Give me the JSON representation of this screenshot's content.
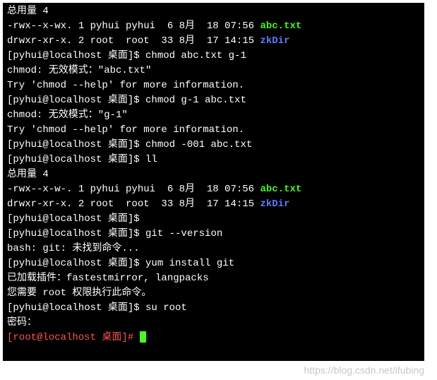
{
  "lines": [
    {
      "segments": [
        {
          "text": "总用量 4",
          "cls": ""
        }
      ]
    },
    {
      "segments": [
        {
          "text": "-rwx--x-wx. 1 pyhui pyhui  6 8月  18 07:56 ",
          "cls": ""
        },
        {
          "text": "abc.txt",
          "cls": "file-green"
        }
      ]
    },
    {
      "segments": [
        {
          "text": "drwxr-xr-x. 2 root  root  33 8月  17 14:15 ",
          "cls": ""
        },
        {
          "text": "zkDir",
          "cls": "dir-blue"
        }
      ]
    },
    {
      "segments": [
        {
          "text": "[pyhui@localhost 桌面]$ chmod abc.txt g-1",
          "cls": ""
        }
      ]
    },
    {
      "segments": [
        {
          "text": "chmod: 无效模式：\"abc.txt\"",
          "cls": ""
        }
      ]
    },
    {
      "segments": [
        {
          "text": "Try 'chmod --help' for more information.",
          "cls": ""
        }
      ]
    },
    {
      "segments": [
        {
          "text": "[pyhui@localhost 桌面]$ chmod g-1 abc.txt",
          "cls": ""
        }
      ]
    },
    {
      "segments": [
        {
          "text": "chmod: 无效模式：\"g-1\"",
          "cls": ""
        }
      ]
    },
    {
      "segments": [
        {
          "text": "Try 'chmod --help' for more information.",
          "cls": ""
        }
      ]
    },
    {
      "segments": [
        {
          "text": "[pyhui@localhost 桌面]$ chmod -001 abc.txt",
          "cls": ""
        }
      ]
    },
    {
      "segments": [
        {
          "text": "[pyhui@localhost 桌面]$ ll",
          "cls": ""
        }
      ]
    },
    {
      "segments": [
        {
          "text": "总用量 4",
          "cls": ""
        }
      ]
    },
    {
      "segments": [
        {
          "text": "-rwx--x-w-. 1 pyhui pyhui  6 8月  18 07:56 ",
          "cls": ""
        },
        {
          "text": "abc.txt",
          "cls": "file-green"
        }
      ]
    },
    {
      "segments": [
        {
          "text": "drwxr-xr-x. 2 root  root  33 8月  17 14:15 ",
          "cls": ""
        },
        {
          "text": "zkDir",
          "cls": "dir-blue"
        }
      ]
    },
    {
      "segments": [
        {
          "text": "[pyhui@localhost 桌面]$ ",
          "cls": ""
        }
      ]
    },
    {
      "segments": [
        {
          "text": "[pyhui@localhost 桌面]$ git --version",
          "cls": ""
        }
      ]
    },
    {
      "segments": [
        {
          "text": "bash: git: 未找到命令...",
          "cls": ""
        }
      ]
    },
    {
      "segments": [
        {
          "text": "[pyhui@localhost 桌面]$ yum install git",
          "cls": ""
        }
      ]
    },
    {
      "segments": [
        {
          "text": "已加载插件：fastestmirror, langpacks",
          "cls": ""
        }
      ]
    },
    {
      "segments": [
        {
          "text": "您需要 root 权限执行此命令。",
          "cls": ""
        }
      ]
    },
    {
      "segments": [
        {
          "text": "[pyhui@localhost 桌面]$ su root",
          "cls": ""
        }
      ]
    },
    {
      "segments": [
        {
          "text": "密码：",
          "cls": ""
        }
      ]
    },
    {
      "segments": [
        {
          "text": "[root@localhost 桌面]# ",
          "cls": "root-prompt"
        }
      ],
      "cursor": true
    }
  ],
  "watermark": "https://blog.csdn.net/ifubing"
}
